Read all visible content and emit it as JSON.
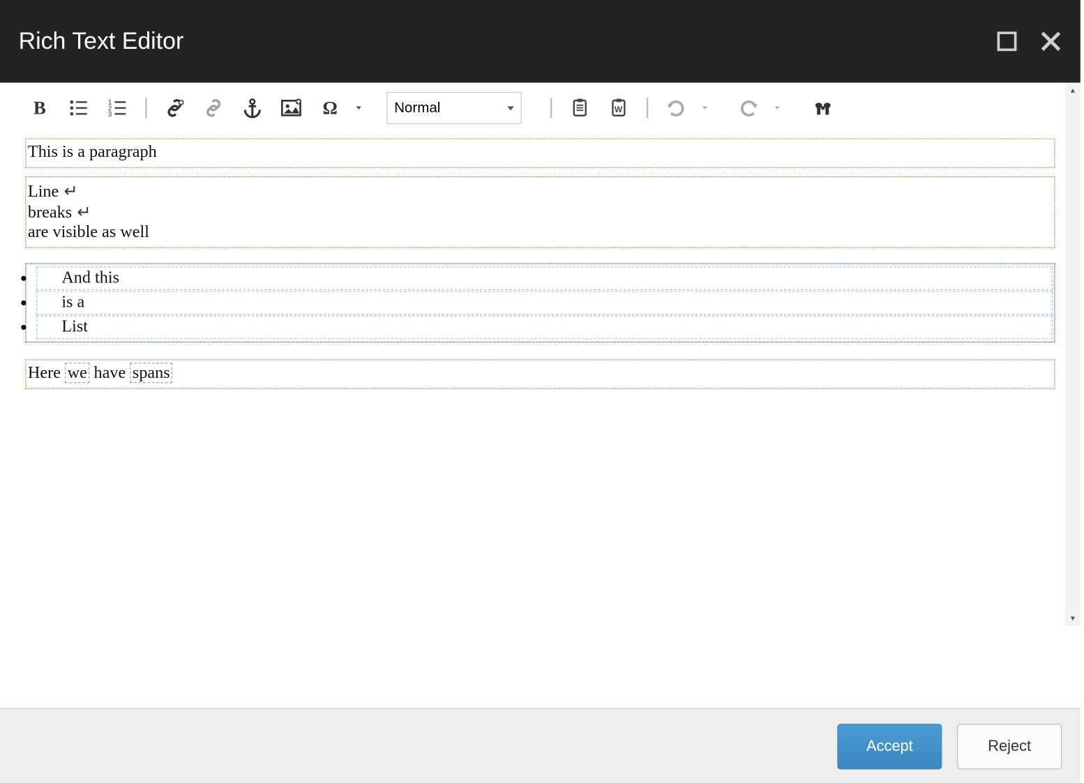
{
  "window": {
    "title": "Rich Text Editor"
  },
  "toolbar": {
    "bold": "B",
    "format_label": "Normal"
  },
  "content": {
    "para1": "This is a paragraph",
    "para2_line1": "Line",
    "para2_line2": "breaks",
    "para2_line3": "are visible as well",
    "list": [
      "And this",
      "is a",
      "List"
    ],
    "para3_pre": "Here ",
    "para3_span1": "we",
    "para3_mid": " have ",
    "para3_span2": "spans"
  },
  "footer": {
    "accept": "Accept",
    "reject": "Reject"
  }
}
